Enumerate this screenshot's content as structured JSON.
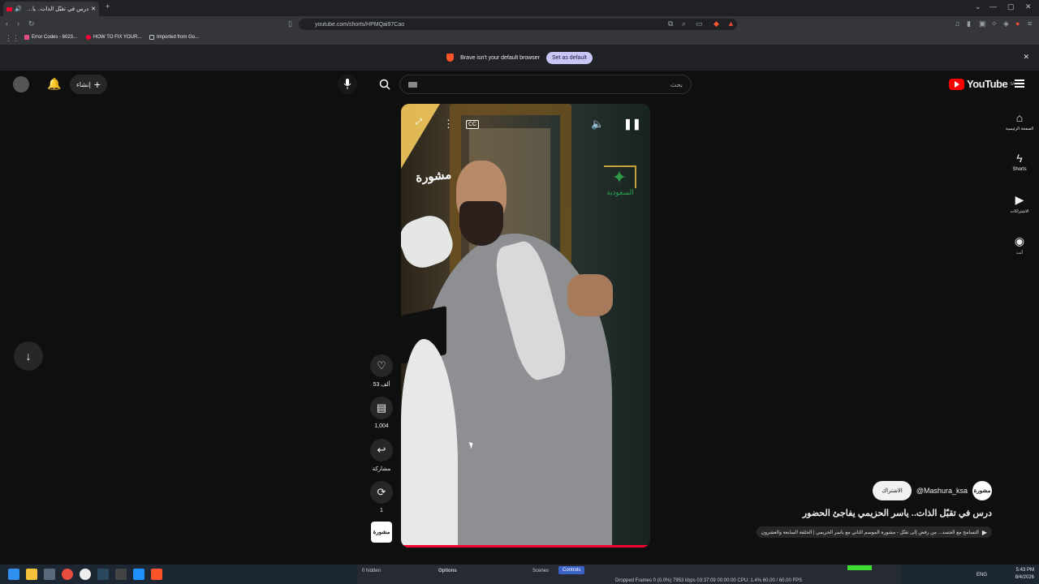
{
  "browser": {
    "tab_title": "درس في تقبّل الذات.. ياسر الحز",
    "new_tab_icon": "+",
    "url": "youtube.com/shorts/HPMQai97Cao",
    "bookmarks": [
      "Error Codes - 6023...",
      "HOW TO FIX YOUR...",
      "Imported from Go..."
    ],
    "infobar_text": "Brave isn't your default browser",
    "infobar_button": "Set as default"
  },
  "youtube": {
    "create_label": "إنشاء",
    "search_placeholder": "بحث",
    "logo_text": "YouTube",
    "logo_country": "SA",
    "sidebar": [
      {
        "icon": "home-icon",
        "label": "الصفحة الرئيسية"
      },
      {
        "icon": "shorts-icon",
        "label": "Shorts"
      },
      {
        "icon": "subscriptions-icon",
        "label": "الاشتراكات"
      },
      {
        "icon": "you-icon",
        "label": "أنت"
      }
    ],
    "video": {
      "watermark_left": "مشورة",
      "watermark_right": "السعودية",
      "progress": 1.0
    },
    "actions": {
      "like_count": "53 ألف",
      "comment_count": "1,004",
      "share_label": "مشاركة",
      "remix_count": "1",
      "channel_thumb": "مشورة"
    },
    "meta": {
      "subscribe_label": "الاشتراك",
      "handle": "@Mashura_ksa",
      "avatar_text": "مشورة",
      "title": "درس في تقبّل الذات.. ياسر الحزيمي يفاجئ الحضور",
      "music": "التسامح مع الجسد... من رفض إلى تقبّل - مشورة الموسم الثاني مع ياسر الحزيمي | الحلقة السابعة والعشرون"
    }
  },
  "taskbar": {
    "obs_hidden": "0 hidden",
    "obs_options": "Options",
    "obs_scenes": "Scenes",
    "obs_controls": "Controls",
    "obs_stats": "Dropped Frames 0 (0.0%)   7953 kbps   03:37:09   00:00:00   CPU: 1.4%   60.00 / 60.00 FPS",
    "lang": "ENG",
    "time": "5:43 PM",
    "date": "8/4/2026"
  },
  "colors": {
    "accent_red": "#ff0033",
    "background": "#0f0f0f"
  }
}
